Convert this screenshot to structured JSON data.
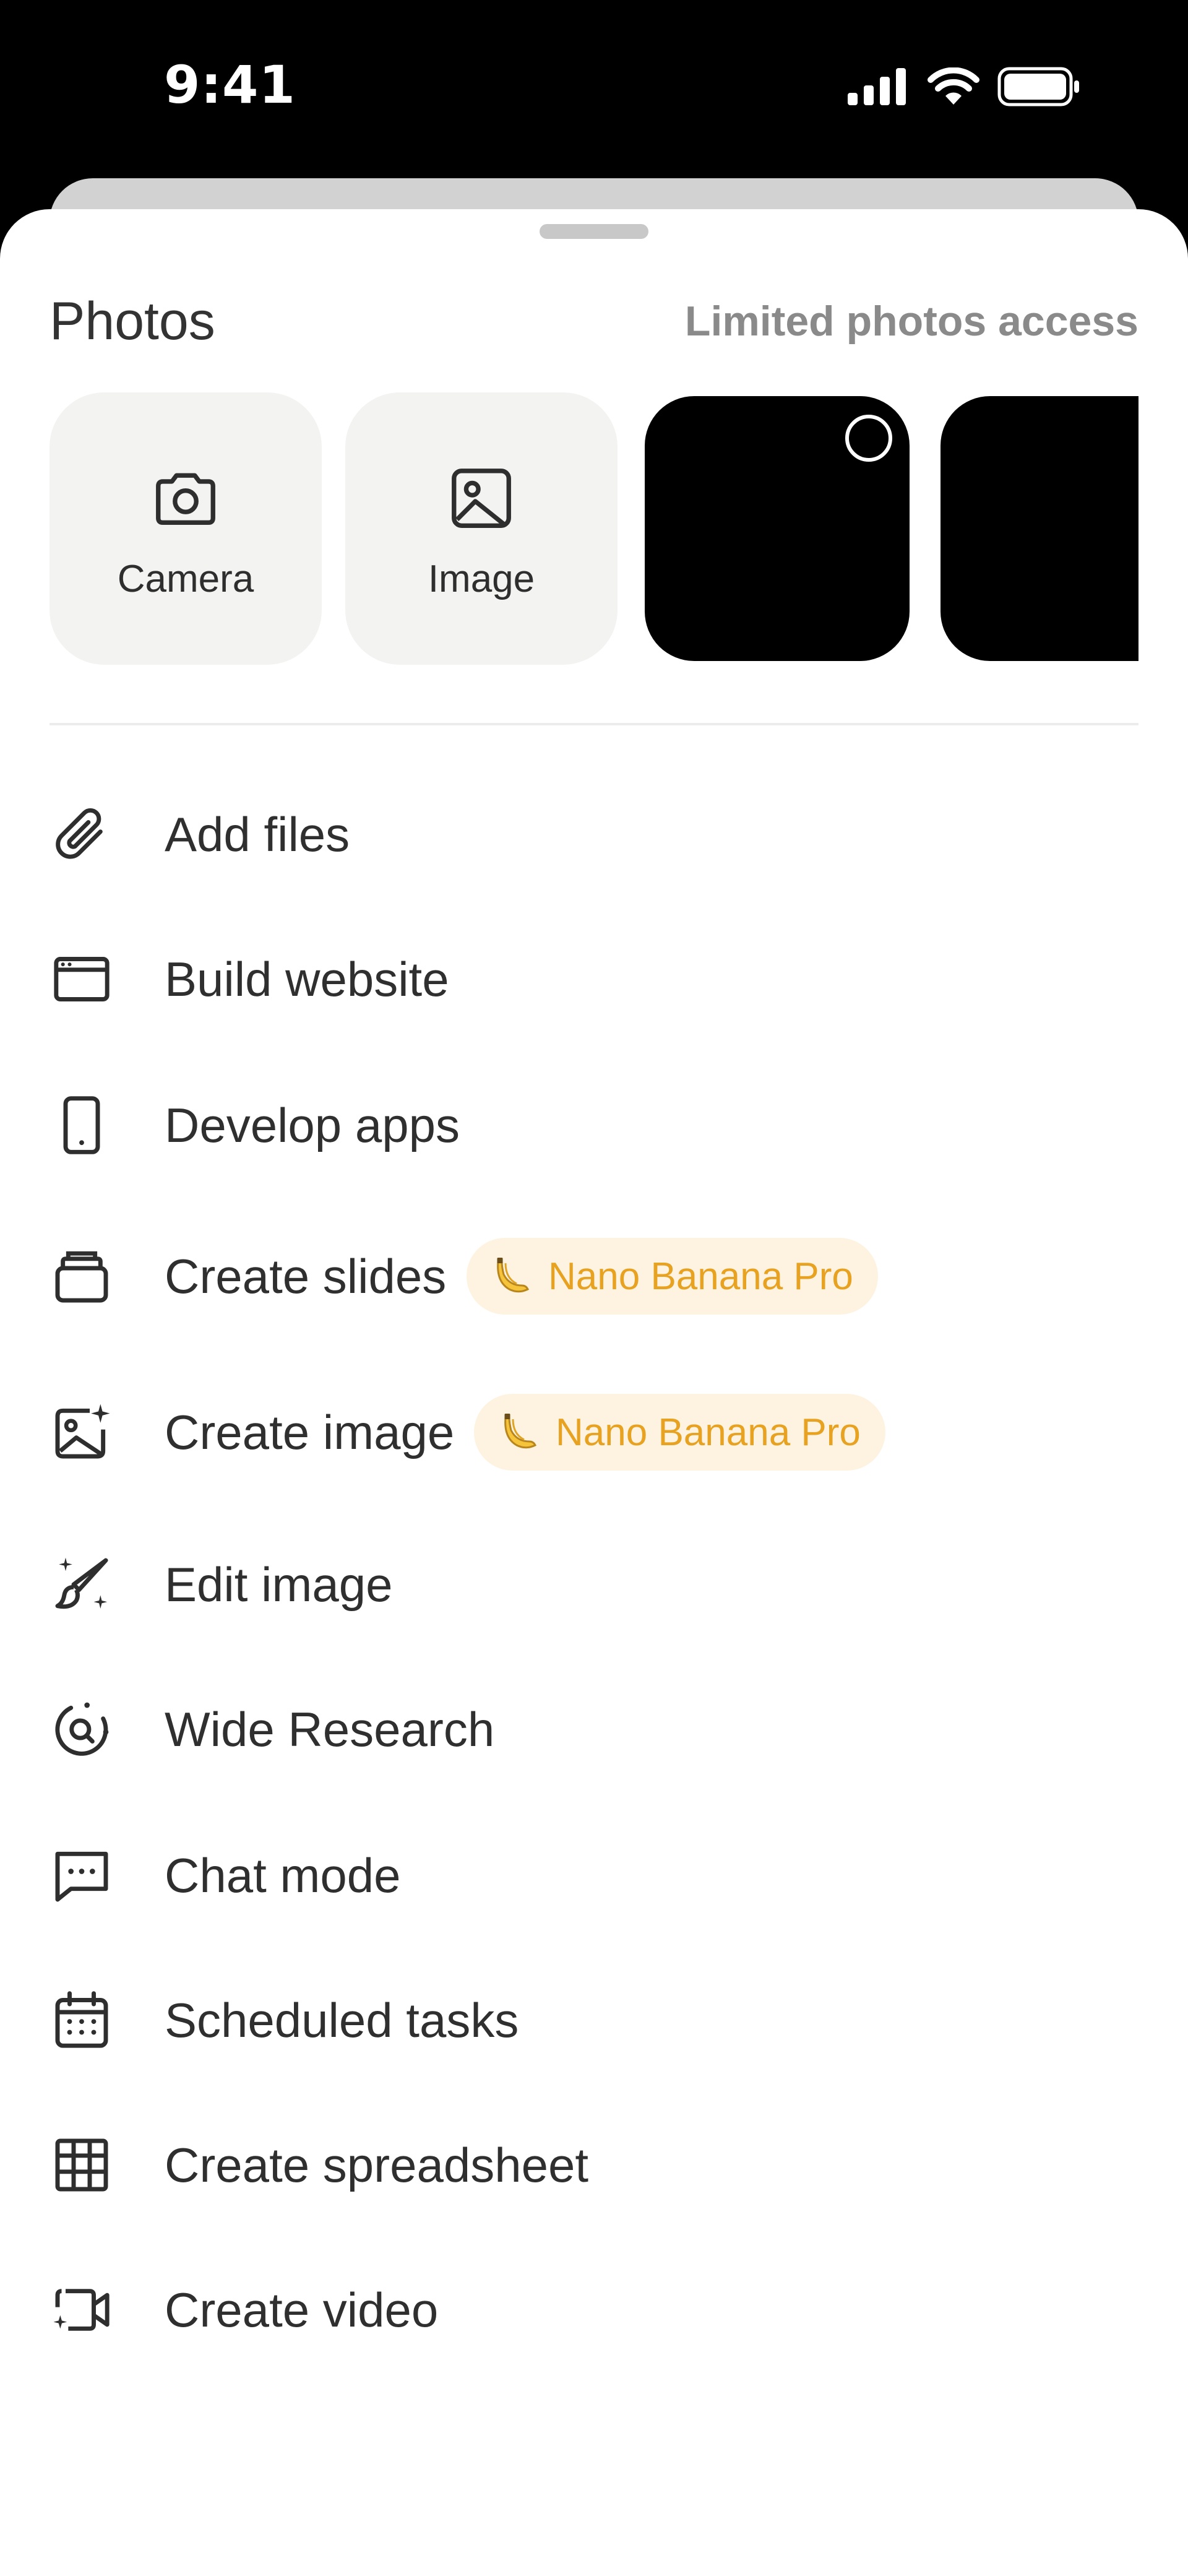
{
  "status_bar": {
    "time": "9:41"
  },
  "sheet": {
    "title": "Photos",
    "access_link": "Limited photos access",
    "tiles": [
      {
        "label": "Camera",
        "icon": "camera-icon"
      },
      {
        "label": "Image",
        "icon": "image-icon"
      }
    ]
  },
  "menu": {
    "items": [
      {
        "label": "Add files",
        "icon": "paperclip-icon"
      },
      {
        "label": "Build website",
        "icon": "browser-window-icon"
      },
      {
        "label": "Develop apps",
        "icon": "smartphone-icon"
      },
      {
        "label": "Create slides",
        "icon": "slides-stack-icon",
        "badge": "Nano Banana Pro"
      },
      {
        "label": "Create image",
        "icon": "image-sparkle-icon",
        "badge": "Nano Banana Pro"
      },
      {
        "label": "Edit image",
        "icon": "brush-sparkle-icon"
      },
      {
        "label": "Wide Research",
        "icon": "research-orbit-icon"
      },
      {
        "label": "Chat mode",
        "icon": "chat-bubble-icon"
      },
      {
        "label": "Scheduled tasks",
        "icon": "calendar-icon"
      },
      {
        "label": "Create spreadsheet",
        "icon": "table-grid-icon"
      },
      {
        "label": "Create video",
        "icon": "video-camera-icon"
      }
    ]
  },
  "colors": {
    "badge_text": "#e8a221",
    "badge_bg": "#fef3e0",
    "tile_bg": "#f3f3f1"
  }
}
